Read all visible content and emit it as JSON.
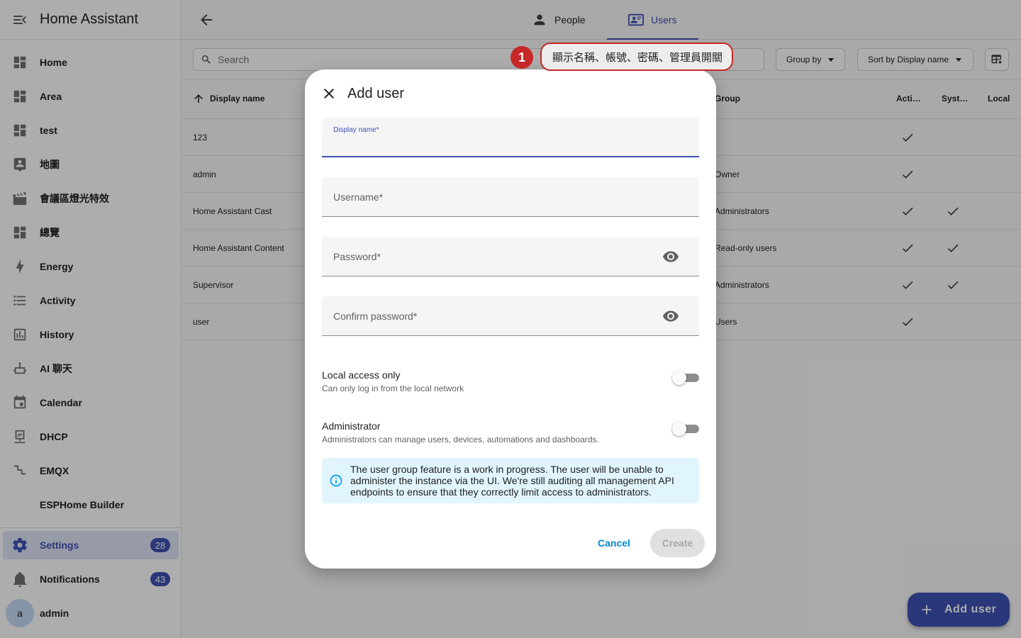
{
  "app": {
    "title": "Home Assistant"
  },
  "sidebar": {
    "items": [
      {
        "label": "Home",
        "icon": "dashboard-icon"
      },
      {
        "label": "Area",
        "icon": "dashboard-icon"
      },
      {
        "label": "test",
        "icon": "dashboard-icon"
      },
      {
        "label": "地圖",
        "icon": "map-account-icon"
      },
      {
        "label": "會議區燈光特效",
        "icon": "movie-clapper-icon"
      },
      {
        "label": "總覽",
        "icon": "dashboard-icon"
      },
      {
        "label": "Energy",
        "icon": "lightning-icon"
      },
      {
        "label": "Activity",
        "icon": "list-icon"
      },
      {
        "label": "History",
        "icon": "chart-box-icon"
      },
      {
        "label": "AI 聊天",
        "icon": "robot-icon"
      },
      {
        "label": "Calendar",
        "icon": "calendar-icon"
      },
      {
        "label": "DHCP",
        "icon": "ip-network-icon"
      },
      {
        "label": "EMQX",
        "icon": "stairs-icon"
      },
      {
        "label": "ESPHome Builder",
        "icon": ""
      }
    ],
    "settings": {
      "label": "Settings",
      "badge": "28"
    },
    "notifications": {
      "label": "Notifications",
      "badge": "43"
    },
    "user": {
      "label": "admin",
      "initial": "a"
    }
  },
  "tabs": [
    {
      "label": "People"
    },
    {
      "label": "Users"
    }
  ],
  "toolbar": {
    "search_placeholder": "Search",
    "group_by": "Group by",
    "sort_by": "Sort by Display name"
  },
  "table": {
    "headers": {
      "display_name": "Display name",
      "group": "Group",
      "active": "Acti…",
      "system": "Syst…",
      "local": "Local"
    },
    "rows": [
      {
        "name": "123",
        "group": "",
        "active": true,
        "system": false
      },
      {
        "name": "admin",
        "group": "Owner",
        "active": true,
        "system": false
      },
      {
        "name": "Home Assistant Cast",
        "group": "Administrators",
        "active": true,
        "system": true
      },
      {
        "name": "Home Assistant Content",
        "group": "Read-only users",
        "active": true,
        "system": true
      },
      {
        "name": "Supervisor",
        "group": "Administrators",
        "active": true,
        "system": true
      },
      {
        "name": "user",
        "group": "Users",
        "active": true,
        "system": false
      }
    ]
  },
  "fab": {
    "label": "Add user"
  },
  "annotation": {
    "number": "1",
    "text": "顯示名稱、帳號、密碼、管理員開關"
  },
  "dialog": {
    "title": "Add user",
    "fields": {
      "display_name": {
        "label": "Display name*",
        "value": ""
      },
      "username": {
        "label": "Username*",
        "value": ""
      },
      "password": {
        "label": "Password*",
        "value": ""
      },
      "confirm_password": {
        "label": "Confirm password*",
        "value": ""
      }
    },
    "local_only": {
      "title": "Local access only",
      "subtitle": "Can only log in from the local network",
      "on": false
    },
    "administrator": {
      "title": "Administrator",
      "subtitle": "Administrators can manage users, devices, automations and dashboards.",
      "on": false
    },
    "info": "The user group feature is a work in progress. The user will be unable to administer the instance via the UI. We're still auditing all management API endpoints to ensure that they correctly limit access to administrators.",
    "cancel": "Cancel",
    "create": "Create"
  },
  "colors": {
    "primary": "#3f51b5",
    "accent": "#03a9f4",
    "annotation": "#c62828",
    "info_bg": "#e1f5fe"
  }
}
